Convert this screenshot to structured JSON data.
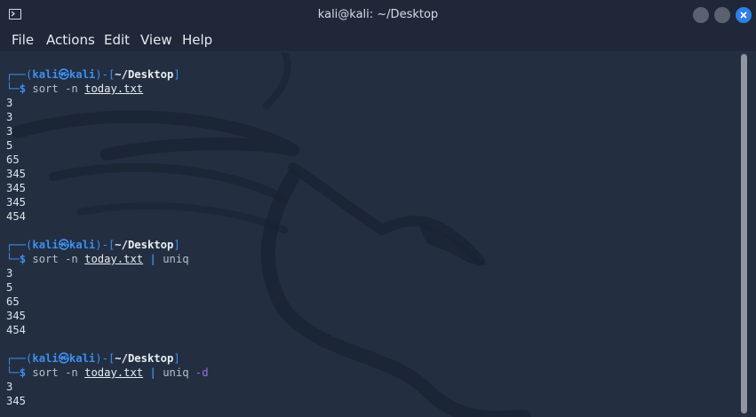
{
  "window": {
    "title": "kali@kali: ~/Desktop",
    "icon": "terminal-icon",
    "buttons": [
      "minimize",
      "maximize",
      "close"
    ],
    "accent": "#2e80e6"
  },
  "menubar": {
    "items": [
      "File",
      "Actions",
      "Edit",
      "View",
      "Help"
    ]
  },
  "prompt": {
    "user": "kali",
    "host": "kali",
    "dir": "~/Desktop",
    "symbol": "$"
  },
  "commands": [
    {
      "cmd": "sort",
      "flag": "-n",
      "file": "today.txt",
      "output": [
        "3",
        "3",
        "3",
        "5",
        "65",
        "345",
        "345",
        "345",
        "454"
      ]
    },
    {
      "cmd": "sort",
      "flag": "-n",
      "file": "today.txt",
      "pipe": "|",
      "cmd2": "uniq",
      "output": [
        "3",
        "5",
        "65",
        "345",
        "454"
      ]
    },
    {
      "cmd": "sort",
      "flag": "-n",
      "file": "today.txt",
      "pipe": "|",
      "cmd2": "uniq",
      "flag2": "-d",
      "output": [
        "3",
        "345"
      ]
    }
  ]
}
